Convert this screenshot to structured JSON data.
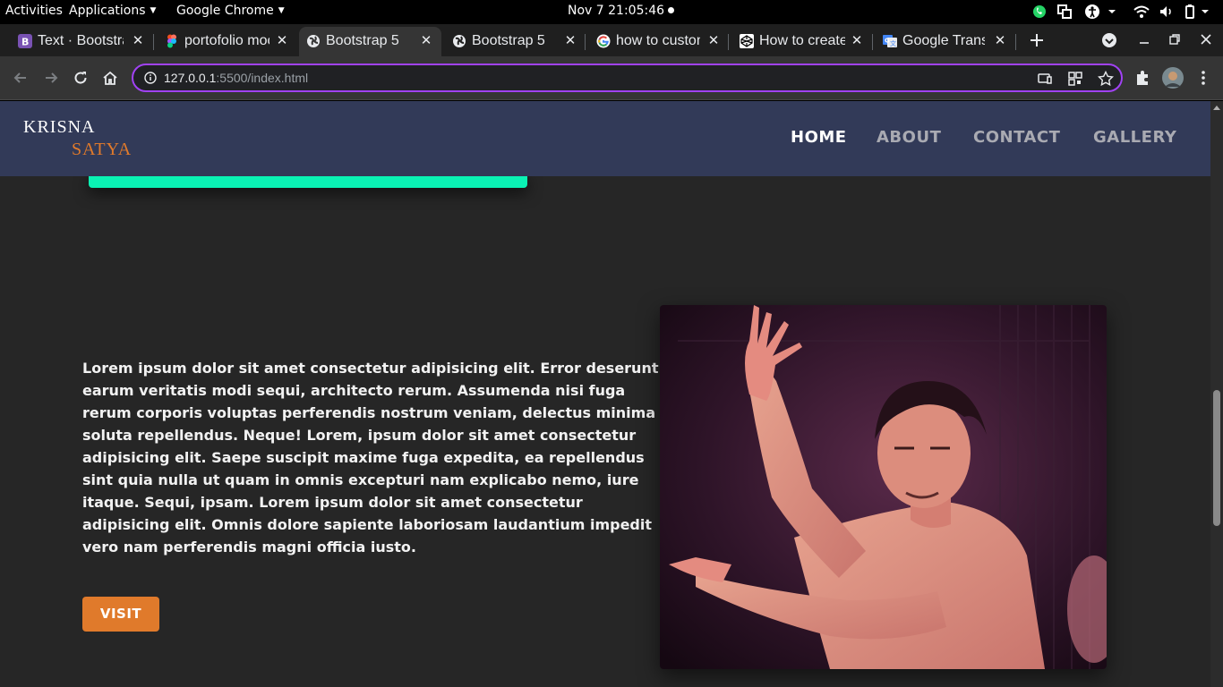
{
  "desktop": {
    "activities": "Activities",
    "applications": "Applications",
    "app_name": "Google Chrome",
    "clock": "Nov 7  21:05:46"
  },
  "tabs": [
    {
      "title": "Text · Bootstrap",
      "favicon": "bootstrap-favicon"
    },
    {
      "title": "portofolio mockup",
      "favicon": "figma-favicon"
    },
    {
      "title": "Bootstrap 5",
      "favicon": "globe-favicon"
    },
    {
      "title": "Bootstrap 5",
      "favicon": "globe-favicon"
    },
    {
      "title": "how to customize",
      "favicon": "google-favicon"
    },
    {
      "title": "How to create",
      "favicon": "codepen-favicon"
    },
    {
      "title": "Google Translate",
      "favicon": "translate-favicon"
    }
  ],
  "active_tab_index": 2,
  "address": {
    "host": "127.0.0.1",
    "rest": ":5500/index.html"
  },
  "site": {
    "logo_line1": "KRISNA",
    "logo_line2": "SATYA",
    "nav": [
      "HOME",
      "ABOUT",
      "CONTACT",
      "GALLERY"
    ],
    "active_nav": "HOME",
    "paragraph": "Lorem ipsum dolor sit amet consectetur adipisicing elit. Error deserunt earum veritatis modi sequi, architecto rerum. Assumenda nisi fuga rerum corporis voluptas perferendis nostrum veniam, delectus minima soluta repellendus. Neque! Lorem, ipsum dolor sit amet consectetur adipisicing elit. Saepe suscipit maxime fuga expedita, ea repellendus sint quia nulla ut quam in omnis excepturi nam explicabo nemo, iure itaque. Sequi, ipsam. Lorem ipsum dolor sit amet consectetur adipisicing elit. Omnis dolore sapiente laboriosam laudantium impedit vero nam perferendis magni officia iusto.",
    "button": "VISIT"
  },
  "colors": {
    "nav_bg": "#323a58",
    "accent_orange": "#e07a2b",
    "accent_green": "#0af2b4",
    "page_bg": "#262626",
    "omnibox_border": "#a142f4"
  }
}
